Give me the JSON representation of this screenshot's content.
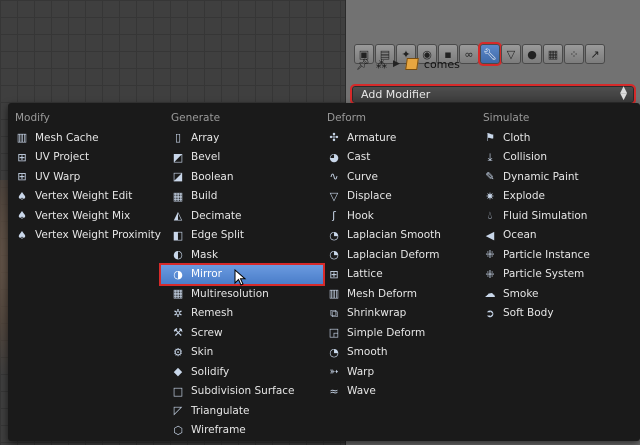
{
  "toolbar": {
    "icons": [
      "render-icon",
      "render-layers-icon",
      "scene-icon",
      "world-icon",
      "object-icon",
      "constraints-icon",
      "modifiers-icon",
      "data-icon",
      "material-icon",
      "texture-icon",
      "particles-icon",
      "physics-icon"
    ],
    "active": "modifiers-icon"
  },
  "breadcrumb": {
    "object_name": "comes"
  },
  "add_modifier": {
    "label": "Add Modifier"
  },
  "menu": {
    "columns": [
      {
        "heading": "Modify",
        "items": [
          "Mesh Cache",
          "UV Project",
          "UV Warp",
          "Vertex Weight Edit",
          "Vertex Weight Mix",
          "Vertex Weight Proximity"
        ]
      },
      {
        "heading": "Generate",
        "items": [
          "Array",
          "Bevel",
          "Boolean",
          "Build",
          "Decimate",
          "Edge Split",
          "Mask",
          "Mirror",
          "Multiresolution",
          "Remesh",
          "Screw",
          "Skin",
          "Solidify",
          "Subdivision Surface",
          "Triangulate",
          "Wireframe"
        ],
        "highlighted": "Mirror"
      },
      {
        "heading": "Deform",
        "items": [
          "Armature",
          "Cast",
          "Curve",
          "Displace",
          "Hook",
          "Laplacian Smooth",
          "Laplacian Deform",
          "Lattice",
          "Mesh Deform",
          "Shrinkwrap",
          "Simple Deform",
          "Smooth",
          "Warp",
          "Wave"
        ]
      },
      {
        "heading": "Simulate",
        "items": [
          "Cloth",
          "Collision",
          "Dynamic Paint",
          "Explode",
          "Fluid Simulation",
          "Ocean",
          "Particle Instance",
          "Particle System",
          "Smoke",
          "Soft Body"
        ]
      }
    ]
  },
  "colors": {
    "menu_bg": "#1a1a1a",
    "highlight": "#5a8ad4",
    "annotation_red": "#d62a2a"
  }
}
